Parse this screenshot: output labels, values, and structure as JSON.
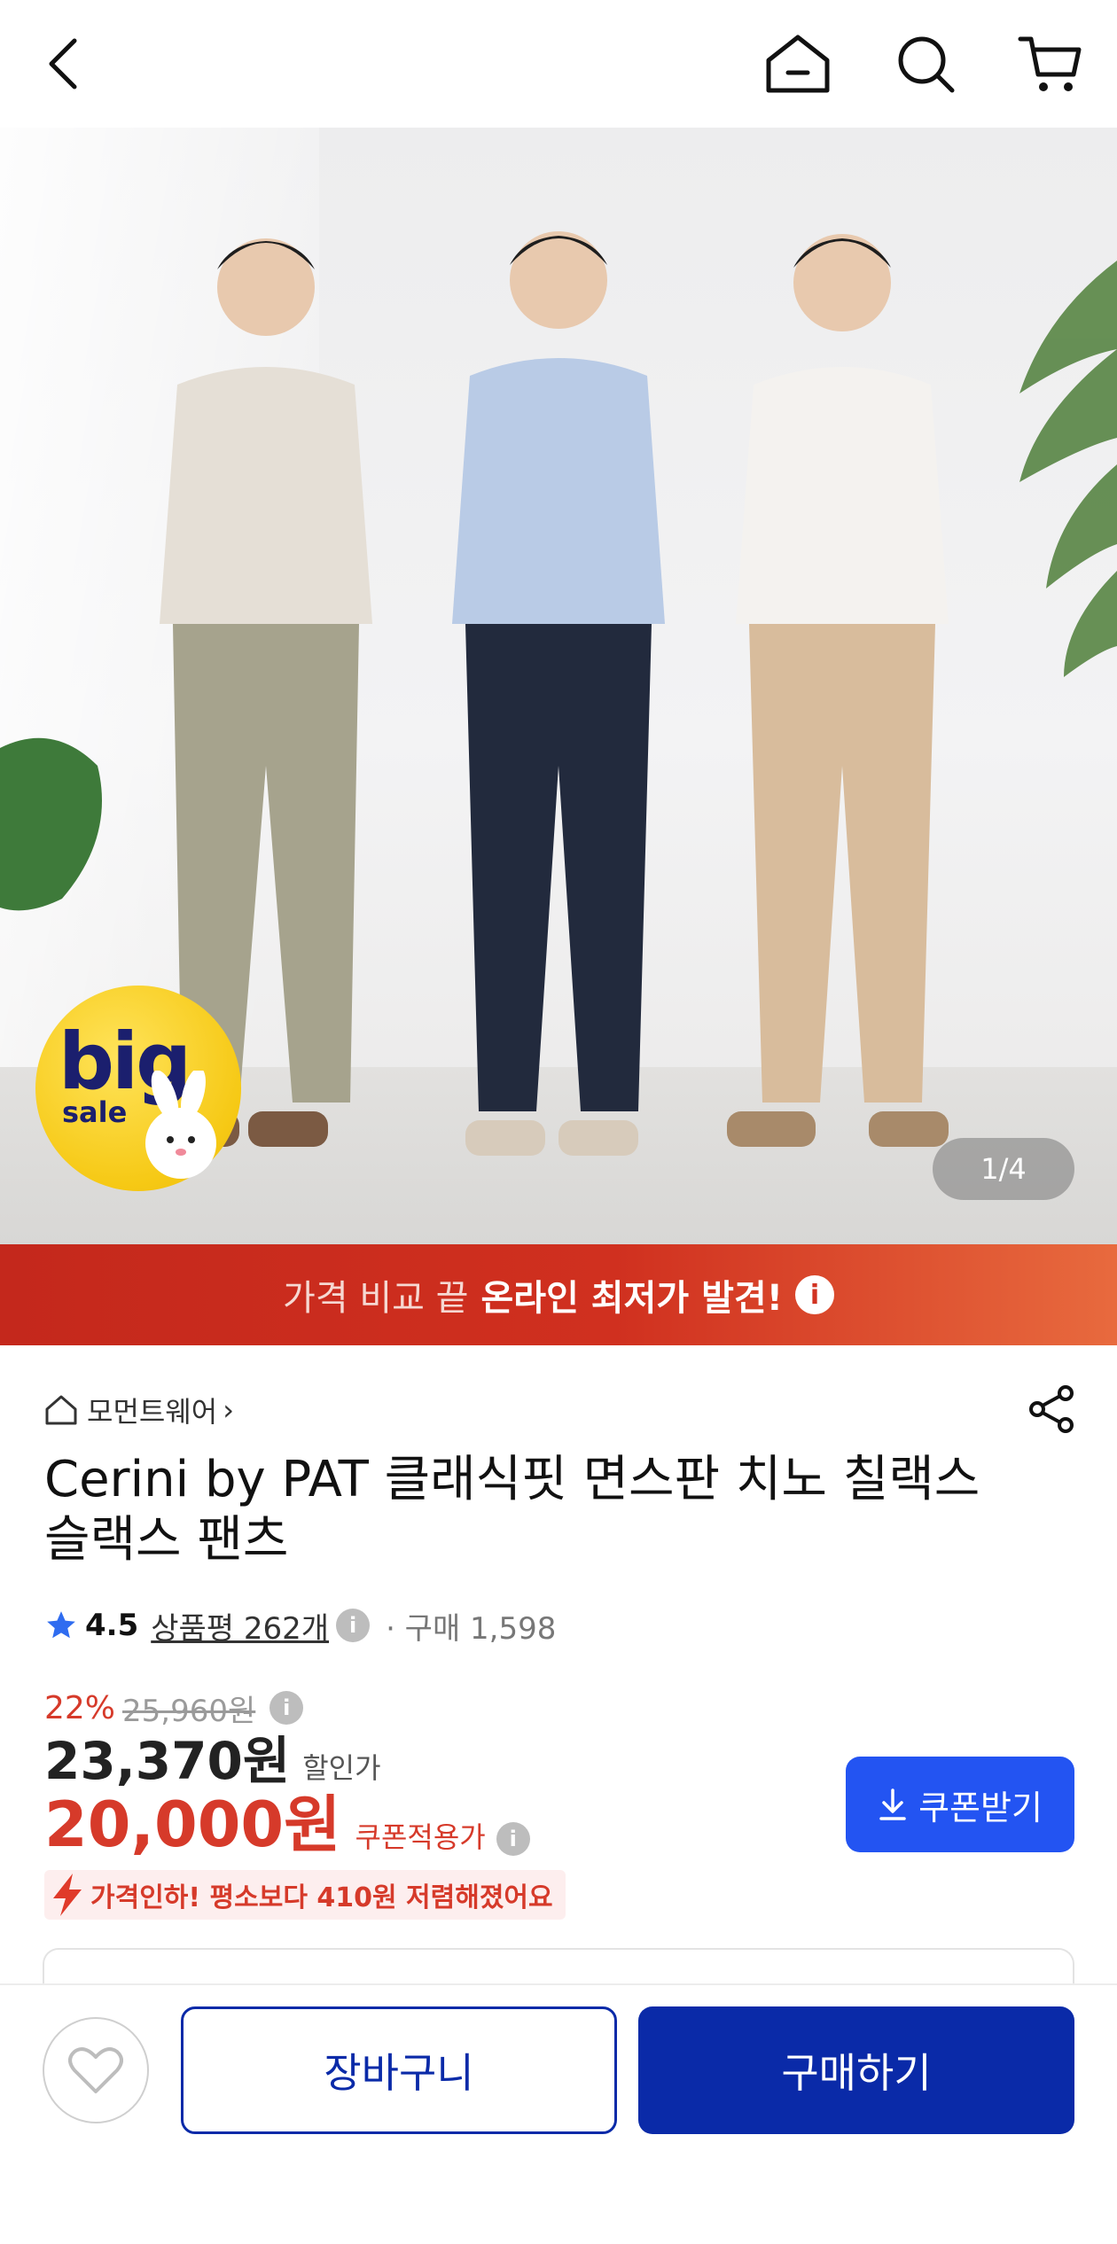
{
  "nav": {
    "back_icon": "chevron-left-icon",
    "home_icon": "home-icon",
    "search_icon": "search-icon",
    "cart_icon": "cart-icon"
  },
  "hero": {
    "counter": "1/4",
    "badge": {
      "big": "big",
      "sale": "sale"
    }
  },
  "promo": {
    "pre": "가격 비교 끝",
    "strong": "온라인 최저가 발견!",
    "info": "i",
    "colors": {
      "start": "#c4281c",
      "end": "#e86a3e"
    }
  },
  "product": {
    "store": "모먼트웨어",
    "store_chevron": "›",
    "title": "Cerini by PAT 클래식핏 면스판 치노 칠랙스 슬랙스 팬츠",
    "rating": "4.5",
    "review_label": "상품평 262개",
    "buys": "· 구매 1,598",
    "discount_rate": "22%",
    "original_price": "25,960원",
    "sale_price": "23,370원",
    "sale_label": "할인가",
    "coupon_price": "20,000원",
    "coupon_label": "쿠폰적용가",
    "coupon_button": "쿠폰받기",
    "price_drop": "가격인하! 평소보다 410원 저렴해졌어요",
    "info": "i"
  },
  "bottom": {
    "cart_button": "장바구니",
    "buy_button": "구매하기"
  },
  "colors": {
    "accent_blue": "#2354f2",
    "primary_navy": "#0a2aa8",
    "sale_red": "#d63a2a"
  }
}
